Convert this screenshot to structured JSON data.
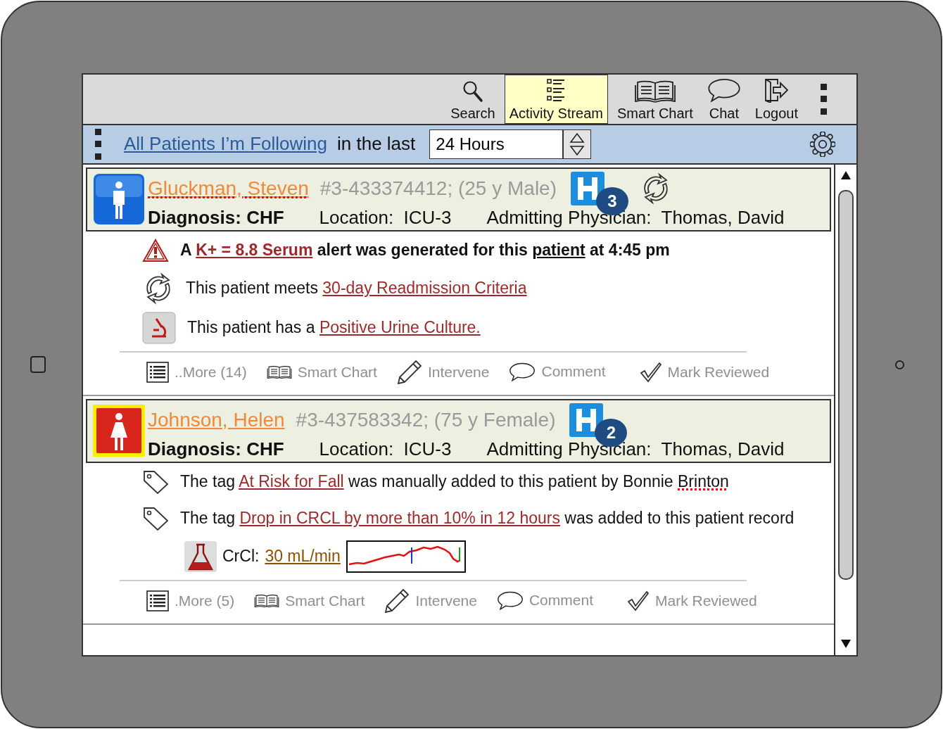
{
  "toolbar": {
    "items": [
      {
        "label": "Search",
        "kind": "search",
        "selected": false
      },
      {
        "label": "Activity Stream",
        "kind": "list",
        "selected": true
      },
      {
        "label": "Smart Chart",
        "kind": "book",
        "selected": false
      },
      {
        "label": "Chat",
        "kind": "chat",
        "selected": false
      },
      {
        "label": "Logout",
        "kind": "logout",
        "selected": false
      }
    ]
  },
  "filter": {
    "link": "All Patients I’m Following",
    "text": "in the last",
    "period": "24 Hours"
  },
  "patients": [
    {
      "avatar": {
        "kind": "male",
        "highlighted": false
      },
      "name": "Gluckman, Steven",
      "name_misspelled": true,
      "record": "#3-433374412; (25 y Male)",
      "hospital_count": "3",
      "readmission_flag": true,
      "diagnosis": "Diagnosis: CHF",
      "location": "Location:  ICU-3",
      "physician": "Admitting Physician:  Thomas, David",
      "events": [
        {
          "kind": "alert",
          "parts": [
            {
              "kind": "text",
              "text": "A "
            },
            {
              "kind": "link",
              "text": "K+ = 8.8 Serum"
            },
            {
              "kind": "text",
              "text": " alert was generated for this "
            },
            {
              "kind": "underline",
              "text": "patient"
            },
            {
              "kind": "text",
              "text": " at 4:45 pm"
            }
          ]
        },
        {
          "kind": "readmission",
          "parts": [
            {
              "kind": "text",
              "text": "This patient meets "
            },
            {
              "kind": "link",
              "text": "30-day Readmission Criteria"
            }
          ]
        },
        {
          "kind": "culture",
          "parts": [
            {
              "kind": "text",
              "text": "This patient has a "
            },
            {
              "kind": "link",
              "text": "Positive Urine Culture."
            }
          ]
        }
      ],
      "actions": [
        {
          "kind": "more",
          "label": "..More (14)"
        },
        {
          "kind": "book",
          "label": "Smart Chart"
        },
        {
          "kind": "pencil",
          "label": "Intervene"
        },
        {
          "kind": "chat",
          "label": "Comment"
        },
        {
          "kind": "check",
          "label": "Mark Reviewed"
        }
      ]
    },
    {
      "avatar": {
        "kind": "female",
        "highlighted": true
      },
      "name": "Johnson, Helen",
      "name_misspelled": false,
      "record": "#3-437583342; (75 y Female)",
      "hospital_count": "2",
      "readmission_flag": false,
      "diagnosis": "Diagnosis: CHF",
      "location": "Location:  ICU-3",
      "physician": "Admitting Physician:  Thomas, David",
      "events": [
        {
          "kind": "tag",
          "parts": [
            {
              "kind": "text",
              "text": "The tag "
            },
            {
              "kind": "link",
              "text": "At Risk for Fall"
            },
            {
              "kind": "text",
              "text": " was manually added to this patient by Bonnie "
            },
            {
              "kind": "misspelled",
              "text": "Brinton"
            }
          ]
        },
        {
          "kind": "tag",
          "parts": [
            {
              "kind": "text",
              "text": "The tag "
            },
            {
              "kind": "link",
              "text": "Drop in CRCL by more than 10% in 12 hours"
            },
            {
              "kind": "text",
              "text": " was added to this patient record"
            }
          ]
        },
        {
          "kind": "lab_value",
          "label": "CrCl:",
          "value": "30 mL/min"
        }
      ],
      "actions": [
        {
          "kind": "more",
          "label": ".More (5)"
        },
        {
          "kind": "book",
          "label": "Smart Chart"
        },
        {
          "kind": "pencil",
          "label": "Intervene"
        },
        {
          "kind": "chat",
          "label": "Comment"
        },
        {
          "kind": "check",
          "label": "Mark Reviewed"
        }
      ]
    }
  ]
}
